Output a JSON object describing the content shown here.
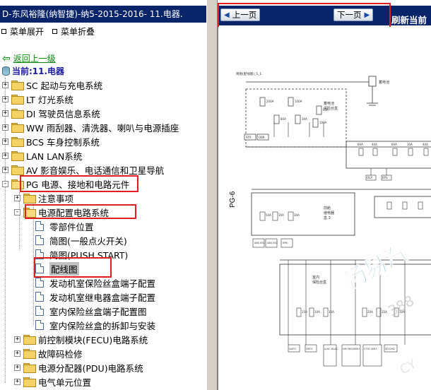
{
  "left_panel": {
    "title": "D-东风裕隆(纳智捷)-纳5-2015-2016- 11.电器.",
    "menu": {
      "expand_all": "菜单展开",
      "collapse_all": "菜单折叠"
    },
    "back_label": "返回上一级",
    "current_label": "当前:11.电器",
    "tree": [
      {
        "label": "SC 起动与充电系统"
      },
      {
        "label": "LT 灯光系统"
      },
      {
        "label": "DI 驾驶员信息系统"
      },
      {
        "label": "WW 雨刮器、清洗器、喇叭与电源插座"
      },
      {
        "label": "BCS 车身控制系统"
      },
      {
        "label": "LAN LAN系统"
      },
      {
        "label": "AV 影音娱乐、电话通信和卫星导航"
      },
      {
        "label": "PG 电源、接地和电路元件"
      },
      {
        "label": "注意事项"
      },
      {
        "label": "电源配置电路系统"
      },
      {
        "label": "零部件位置"
      },
      {
        "label": "简图(一般点火开关)"
      },
      {
        "label": "简图(PUSH START)"
      },
      {
        "label": "配线图"
      },
      {
        "label": "发动机室保险丝盒端子配置"
      },
      {
        "label": "发动机室继电器盒端子配置"
      },
      {
        "label": "室内保险丝盒端子配置图"
      },
      {
        "label": "室内保险丝盒的拆卸与安装"
      },
      {
        "label": "前控制模块(FECU)电路系统"
      },
      {
        "label": "故障码检修"
      },
      {
        "label": "电源分配器(PDU)电路系统"
      },
      {
        "label": "电气单元位置"
      }
    ]
  },
  "right_panel": {
    "prev_label": "上一页",
    "next_label": "下一页",
    "refresh_label": "刷新当前",
    "diagram": {
      "page_label": "PG-6",
      "header_text": "简图(配线图)_5_1",
      "battery_label": "蓄电池",
      "box1_label": "蓄电池\n保险丝盒",
      "box2_label": "前舱\n继电器\n盒.3",
      "box3_label": "室内\n保险丝盒",
      "fuses": [
        "200A",
        "100A",
        "80A",
        "30A",
        "50A",
        "60A",
        "40A",
        "15A",
        "10A",
        "20A"
      ],
      "connectors": [
        "STR",
        "OBR",
        "OLP",
        "EPS",
        "ABS ESC",
        "ABS ESC",
        "EPB",
        "DUFG",
        "DEFG",
        "A/AC MLAC",
        "HM 5KG/MMU SY 3CGWR CCSNET 7PMS",
        "CTSY SMLT TRIMO CAN1 CAN2 BCM",
        "SD DVD"
      ],
      "watermark": "畅易汽"
    },
    "colors": {
      "accent": "#0a246a",
      "highlight": "#e02020"
    }
  }
}
